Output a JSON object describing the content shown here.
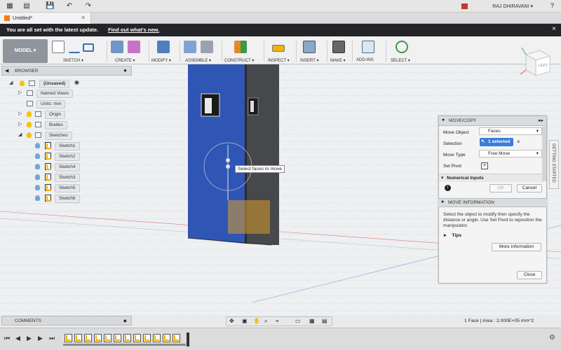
{
  "titlebar": {
    "doc_title": "Untitled*",
    "user_name": "RAJ DHIRAVANI ▾",
    "help_icon": "help-icon"
  },
  "notification": {
    "message": "You are all set with the latest update.",
    "link": "Find out what's new."
  },
  "toolbar": {
    "workspace": "MODEL ▾",
    "groups": [
      "SKETCH ▾",
      "CREATE ▾",
      "MODIFY ▾",
      "ASSEMBLE ▾",
      "CONSTRUCT ▾",
      "INSPECT ▾",
      "INSERT ▾",
      "MAKE ▾",
      "ADD-INS",
      "SELECT ▾"
    ]
  },
  "viewcube": {
    "face_label": "LEFT"
  },
  "browser": {
    "title": "BROWSER",
    "root": "(Unsaved)",
    "named_views": "Named Views",
    "units": "Units: mm",
    "origin": "Origin",
    "bodies": "Bodies",
    "sketches": "Sketches",
    "sketch_items": [
      "Sketch1",
      "Sketch2",
      "Sketch4",
      "Sketch3",
      "Sketch5",
      "Sketch6"
    ]
  },
  "tooltip": "Select faces to move",
  "move_panel": {
    "title": "MOVE/COPY",
    "move_object_label": "Move Object",
    "move_object_value": "Faces",
    "selection_label": "Selection",
    "selection_value": "1 selected",
    "move_type_label": "Move Type",
    "move_type_value": "Free Move",
    "set_pivot_label": "Set Pivot",
    "numerical_inputs": "Numerical Inputs",
    "ok": "OK",
    "cancel": "Cancel"
  },
  "move_info": {
    "title": "MOVE INFORMATION",
    "text": "Select the object to modify then specify the distance or angle. Use Set Pivot to reposition the manipulator.",
    "tips": "Tips",
    "more_info": "More Information",
    "close": "Close"
  },
  "getting_started": "GETTING STARTED",
  "comments": {
    "title": "COMMENTS"
  },
  "status": "1 Face | Area : 2.000E+05 mm^2",
  "colors": {
    "selected_face": "#2f55b5",
    "body_dark": "#3a3b3d",
    "accent_blue": "#3b7dd8",
    "notify_bg": "#222428"
  }
}
